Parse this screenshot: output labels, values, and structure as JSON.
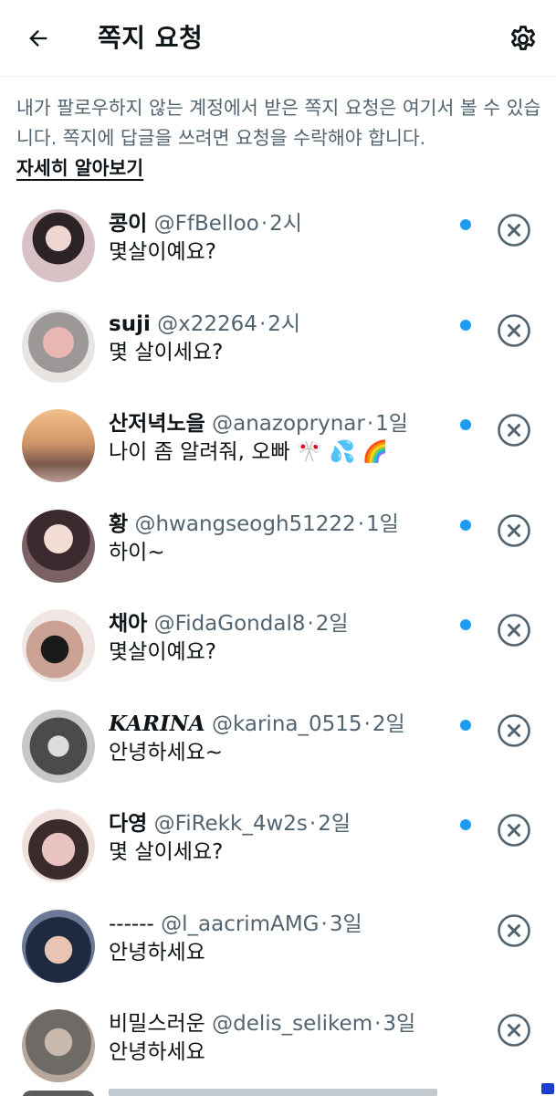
{
  "header": {
    "title": "쪽지 요청",
    "back_icon": "arrow-left-icon",
    "settings_icon": "gear-icon"
  },
  "info": {
    "text": "내가 팔로우하지 않는 계정에서 받은 쪽지 요청은 여기서 볼 수 있습니다. 쪽지에 답글을 쓰려면 요청을 수락해야 합니다.",
    "link": "자세히 알아보기"
  },
  "colors": {
    "accent": "#1d9bf0",
    "text_primary": "#0f1419",
    "text_secondary": "#536471",
    "divider": "#eff3f4"
  },
  "requests": [
    {
      "name": "콩이",
      "handle": "@FfBelloo",
      "time": "2시",
      "message": "몇살이예요?",
      "unread": true
    },
    {
      "name": "suji",
      "handle": "@x22264",
      "time": "2시",
      "message": "몇 살이세요?",
      "unread": true
    },
    {
      "name": "산저녁노을",
      "handle": "@anazoprynar",
      "time": "1일",
      "message": "나이 좀 알려줘, 오빠 🎌 💦 🌈",
      "unread": true
    },
    {
      "name": "황",
      "handle": "@hwangseogh51222",
      "time": "1일",
      "message": "하이~",
      "unread": true
    },
    {
      "name": "채아",
      "handle": "@FidaGondal8",
      "time": "2일",
      "message": "몇살이예요?",
      "unread": true
    },
    {
      "name": "KARINA",
      "handle": "@karina_0515",
      "time": "2일",
      "message": "안녕하세요~",
      "unread": true
    },
    {
      "name": "다영",
      "handle": "@FiRekk_4w2s",
      "time": "2일",
      "message": "몇 살이세요?",
      "unread": true
    },
    {
      "name": "------",
      "handle": "@l_aacrimAMG",
      "time": "3일",
      "message": "안녕하세요",
      "unread": false
    },
    {
      "name": "비밀스러운",
      "handle": "@delis_selikem",
      "time": "3일",
      "message": "안녕하세요",
      "unread": false
    }
  ]
}
